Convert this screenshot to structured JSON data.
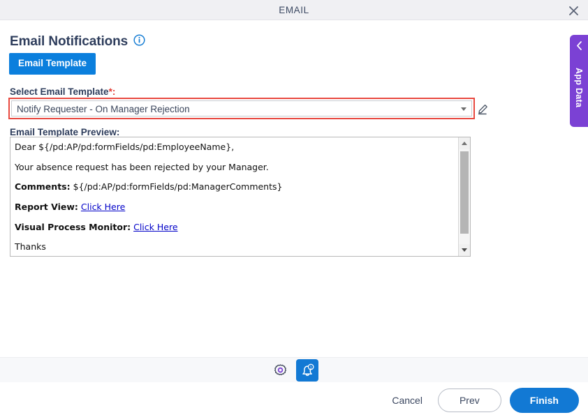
{
  "window": {
    "title": "EMAIL",
    "close_icon": "close-icon"
  },
  "header": {
    "page_title": "Email Notifications",
    "info_icon": "info-icon",
    "tab_label": "Email Template"
  },
  "form": {
    "select_label": "Select Email Template",
    "select_required_marker": "*:",
    "select_value": "Notify Requester - On Manager Rejection",
    "select_caret_icon": "chevron-down-icon",
    "edit_icon": "pencil-edit-icon",
    "preview_label": "Email Template Preview:"
  },
  "preview": {
    "lines": [
      {
        "text": "Dear ${/pd:AP/pd:formFields/pd:EmployeeName},",
        "bold_prefix": "",
        "link": ""
      },
      {
        "text": "Your absence request has been rejected by your Manager.",
        "bold_prefix": "",
        "link": ""
      },
      {
        "text": "${/pd:AP/pd:formFields/pd:ManagerComments}",
        "bold_prefix": "Comments:",
        "link": ""
      },
      {
        "text": "",
        "bold_prefix": "Report View:",
        "link": "Click Here"
      },
      {
        "text": "",
        "bold_prefix": "Visual Process Monitor:",
        "link": "Click Here"
      },
      {
        "text": "Thanks",
        "bold_prefix": "",
        "link": ""
      }
    ],
    "scrollbar_up_icon": "scroll-up-arrow-icon",
    "scrollbar_down_icon": "scroll-down-arrow-icon"
  },
  "app_data_panel": {
    "label": "App Data",
    "collapse_icon": "chevron-left-icon"
  },
  "toolbar": {
    "gear_icon": "gear-icon",
    "notification_icon": "bell-notification-icon",
    "notification_badge": "1"
  },
  "footer": {
    "cancel_label": "Cancel",
    "prev_label": "Prev",
    "finish_label": "Finish"
  },
  "colors": {
    "accent_blue": "#1279d4",
    "tab_blue": "#0b7fdd",
    "validation_red": "#e8483f",
    "app_data_purple": "#7b41d4",
    "titlebar_gray": "#f0f0f3",
    "toolbar_gray": "#f7f8fa",
    "link_blue": "#0000c8"
  }
}
